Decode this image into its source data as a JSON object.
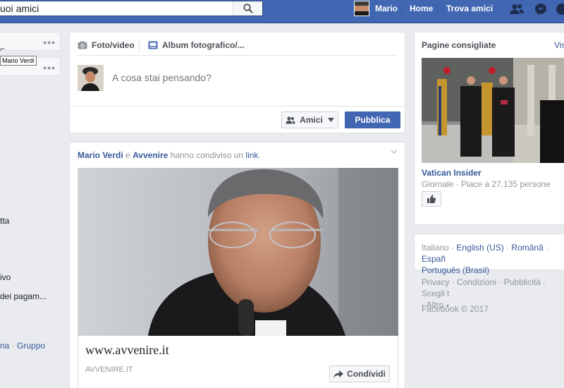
{
  "topbar": {
    "search_placeholder": "uoi amici",
    "user_name": "Mario",
    "nav_home": "Home",
    "nav_find_friends": "Trova amici"
  },
  "left": {
    "tooltip": "Mario Verdi",
    "items": [
      "tta",
      "ivo",
      "dei pagam...",
      "na",
      "Gruppo"
    ]
  },
  "composer": {
    "tab_photo": "Foto/video",
    "tab_album": "Album fotografico/...",
    "placeholder": "A cosa stai pensando?",
    "audience_label": "Amici",
    "publish_label": "Pubblica"
  },
  "post": {
    "actor1": "Mario Verdi",
    "conj": "e",
    "actor2": "Avvenire",
    "action": "hanno condiviso un",
    "link_word": "link",
    "link_title": "www.avvenire.it",
    "link_domain": "AVVENIRE.IT",
    "share_label": "Condividi"
  },
  "sidebar": {
    "title": "Pagine consigliate",
    "see_all": "Visu",
    "page_name": "Vatican Insider",
    "page_meta": "Giornale · Piace a 27.135 persone"
  },
  "languages": {
    "current": "Italiano",
    "options": [
      "English (US)",
      "Română",
      "Españ",
      "Português (Brasil)"
    ]
  },
  "footer": {
    "links": [
      "Privacy",
      "Condizioni",
      "Pubblicità",
      "Scegli t"
    ],
    "more": "Altro",
    "copyright": "Facebook © 2017"
  },
  "colors": {
    "brand": "#4267b2",
    "link": "#365899",
    "muted": "#90949c"
  }
}
